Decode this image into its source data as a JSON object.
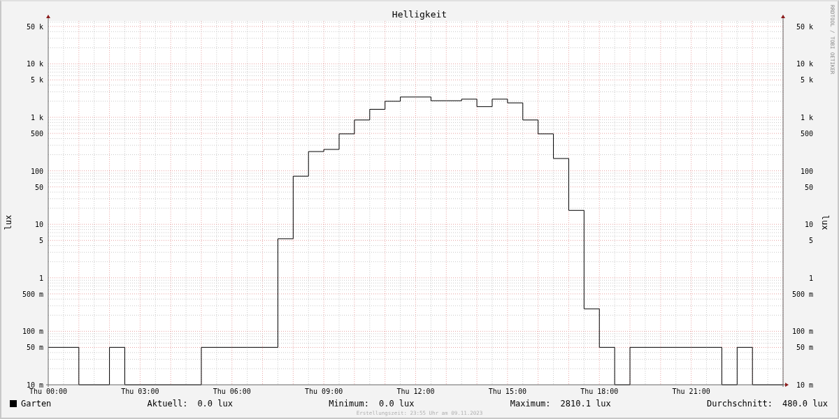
{
  "graph": {
    "title": "Helligkeit",
    "watermark": "RRDTOOL / TOBI OETIKER",
    "left_axis": {
      "label": "lux",
      "ticks": [
        "50 k",
        "10 k",
        "5 k",
        "1 k",
        "500",
        "100",
        "50",
        "10",
        "5",
        "1",
        "500 m",
        "100 m",
        "50 m",
        "10 m"
      ]
    },
    "right_axis": {
      "label": "lux",
      "ticks": [
        "50 k",
        "10 k",
        "5 k",
        "1 k",
        "500",
        "100",
        "50",
        "10",
        "5",
        "1",
        "500 m",
        "100 m",
        "50 m",
        "10 m"
      ]
    },
    "x_axis": {
      "ticks": [
        "Thu 00:00",
        "Thu 03:00",
        "Thu 06:00",
        "Thu 09:00",
        "Thu 12:00",
        "Thu 15:00",
        "Thu 18:00",
        "Thu 21:00"
      ]
    }
  },
  "legend": {
    "name": "Garten",
    "stats": [
      {
        "label": "Aktuell:",
        "value": "0.0 lux"
      },
      {
        "label": "Minimum:",
        "value": "0.0 lux"
      },
      {
        "label": "Maximum:",
        "value": "2810.1 lux"
      },
      {
        "label": "Durchschnitt:",
        "value": "480.0 lux"
      }
    ]
  },
  "footer": "Erstellungszeit: 23:55 Uhr am 09.11.2023"
}
